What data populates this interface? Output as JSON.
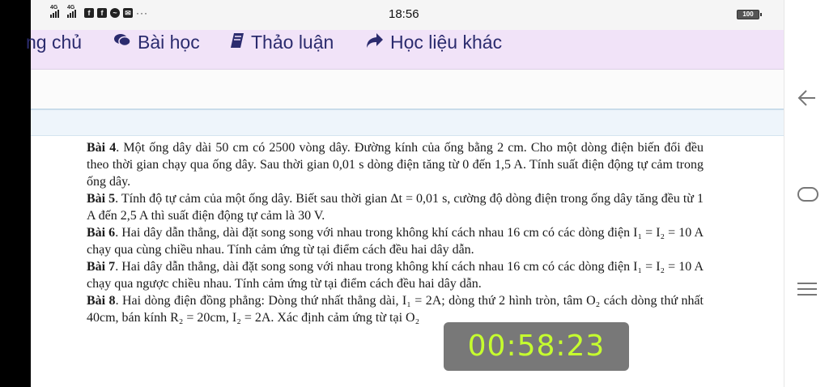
{
  "status_bar": {
    "signal_1": "4G",
    "signal_2": "4G",
    "app_icons": [
      "facebook-icon",
      "facebook-icon",
      "messenger-icon",
      "mail-icon"
    ],
    "more": "···",
    "time": "18:56",
    "battery": "100"
  },
  "nav": {
    "items": [
      {
        "label": "ng chủ",
        "icon": ""
      },
      {
        "label": "Bài học",
        "icon": "chat-icon"
      },
      {
        "label": "Thảo luận",
        "icon": "book-icon"
      },
      {
        "label": "Học liệu khác",
        "icon": "share-arrow-icon"
      }
    ]
  },
  "document": {
    "problems": [
      {
        "title": "Bài 4",
        "text": ". Một ống dây dài 50 cm có 2500 vòng dây. Đường kính của ống bằng 2 cm. Cho một dòng điện biến đổi đều theo thời gian chạy qua ống dây. Sau thời gian 0,01 s dòng điện tăng từ 0 đến 1,5 A. Tính suất điện động tự cảm trong ống dây."
      },
      {
        "title": "Bài 5",
        "text": ". Tính độ tự cảm của một ống dây. Biết sau thời gian Δt = 0,01 s, cường độ dòng điện trong ống dây tăng đều từ 1 A đến 2,5 A thì suất điện động tự cảm là 30 V."
      },
      {
        "title": "Bài 6",
        "text": ". Hai dây dẫn thẳng, dài đặt song song với nhau trong không khí cách nhau 16 cm có các dòng điện I₁ = I₂ = 10 A chạy qua cùng chiều nhau. Tính cảm ứng từ tại điểm cách đều hai dây dẫn."
      },
      {
        "title": "Bài 7",
        "text": ". Hai dây dẫn thẳng, dài đặt song song với nhau trong không khí cách nhau 16 cm có các dòng điện I₁ = I₂ = 10 A chạy qua ngược chiều nhau. Tính cảm ứng từ tại điểm cách đều hai dây dẫn."
      },
      {
        "title": "Bài 8",
        "text": ". Hai dòng điện đồng phẳng: Dòng thứ nhất thẳng dài, I₁ = 2A; dòng thứ 2 hình tròn, tâm O₂ cách dòng thứ nhất 40cm, bán kính R₂ = 20cm, I₂ = 2A. Xác định cảm ứng từ tại O₂"
      }
    ]
  },
  "timer": {
    "value": "00:58:23"
  },
  "system_nav": {
    "back": "back-arrow-icon",
    "home": "home-icon",
    "menu": "menu-icon"
  }
}
